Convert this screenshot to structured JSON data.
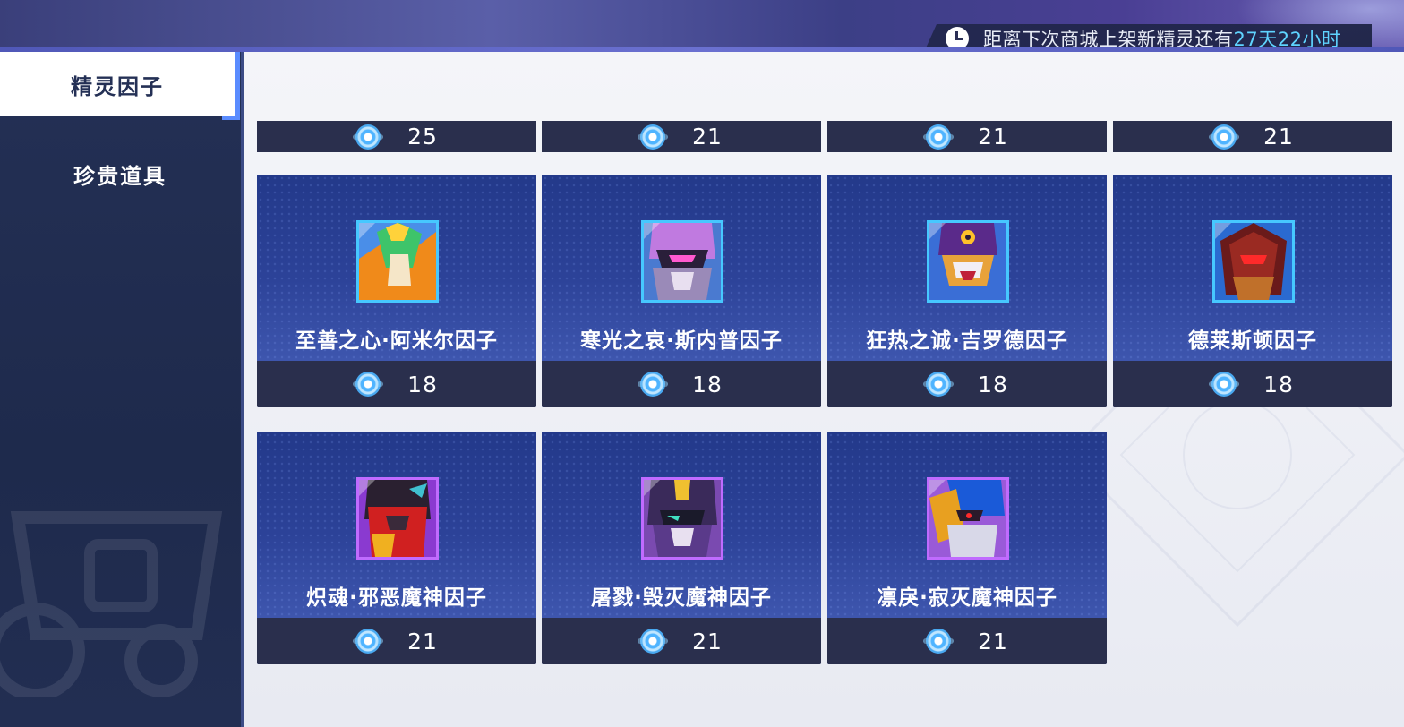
{
  "header": {
    "countdown_prefix": "距离下次商城上架新精灵还有",
    "countdown_time": "27天22小时"
  },
  "sidebar": {
    "tabs": [
      {
        "label": "精灵因子",
        "active": true
      },
      {
        "label": "珍贵道具",
        "active": false
      }
    ]
  },
  "shop": {
    "currency_icon": "crystal-gem-icon",
    "partial_row_prices": [
      "25",
      "21",
      "21",
      "21"
    ],
    "items": [
      {
        "name": "至善之心·阿米尔因子",
        "price": "18",
        "frame": "blue"
      },
      {
        "name": "寒光之哀·斯内普因子",
        "price": "18",
        "frame": "blue"
      },
      {
        "name": "狂热之诚·吉罗德因子",
        "price": "18",
        "frame": "blue"
      },
      {
        "name": "德莱斯顿因子",
        "price": "18",
        "frame": "blue"
      },
      {
        "name": "炽魂·邪恶魔神因子",
        "price": "21",
        "frame": "purple"
      },
      {
        "name": "屠戮·毁灭魔神因子",
        "price": "21",
        "frame": "purple"
      },
      {
        "name": "凛戾·寂灭魔神因子",
        "price": "21",
        "frame": "purple"
      }
    ]
  },
  "colors": {
    "accent": "#5a8cff",
    "countdown_highlight": "#5fd4ff",
    "card_bg": "#2a3e8e",
    "price_bar": "#2a2f4d"
  }
}
